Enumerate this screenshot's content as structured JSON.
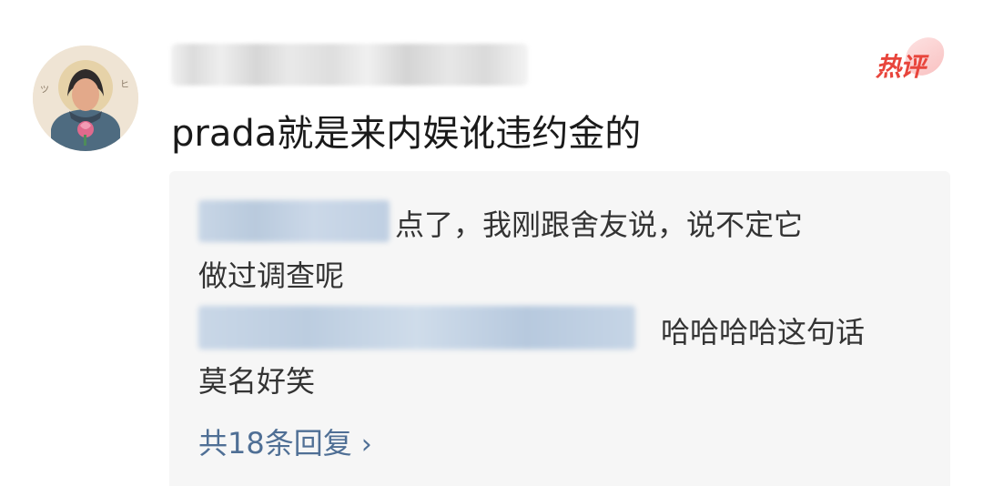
{
  "comment": {
    "badge": "热评",
    "text": "prada就是来内娱讹违约金的"
  },
  "replies": [
    {
      "line1": "点了，我刚跟舍友说，说不定它",
      "line2": "做过调查呢"
    },
    {
      "line1": "哈哈哈哈这句话",
      "line2": "莫名好笑"
    }
  ],
  "more_replies": {
    "label": "共18条回复",
    "icon": "chevron-right-icon"
  },
  "colors": {
    "badge": "#e8453c",
    "link": "#4f6f95",
    "reply_bg": "#f6f6f6"
  }
}
